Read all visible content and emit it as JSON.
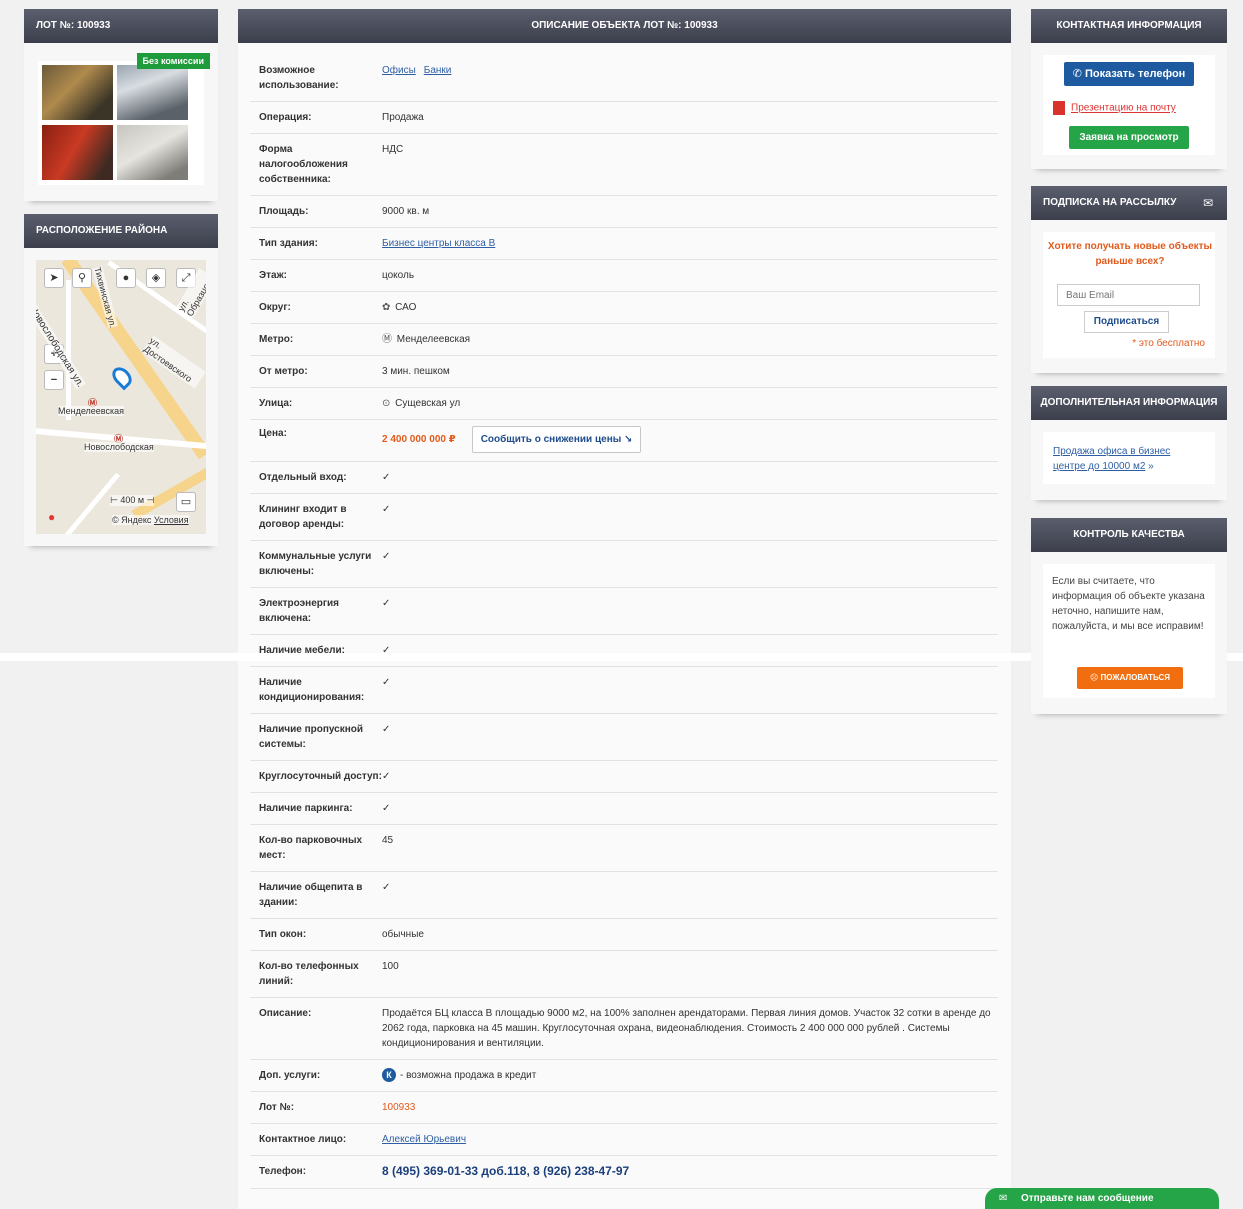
{
  "lot_panel": {
    "title": "ЛОТ №: 100933",
    "badge": "Без комиссии"
  },
  "map_panel": {
    "title": "РАСПОЛОЖЕНИЕ РАЙОНА",
    "labels": {
      "street1": "Новослободская ул.",
      "street2": "ул. Достоевского",
      "street3": "Тихвинская ул.",
      "street4": "ул. Образцова",
      "metro1": "Менделеевская",
      "metro2": "Новослободская",
      "scale": "400 м",
      "copyright": "© Яндекс",
      "terms": "Условия"
    }
  },
  "center_panel": {
    "title": "ОПИСАНИЕ ОБЪЕКТА ЛОТ №: 100933",
    "rows": [
      {
        "label": "Возможное использование:",
        "links": [
          "Офисы",
          "Банки"
        ]
      },
      {
        "label": "Операция:",
        "value": "Продажа"
      },
      {
        "label": "Форма налогообложения собственника:",
        "value": "НДС"
      },
      {
        "label": "Площадь:",
        "value": "9000 кв. м"
      },
      {
        "label": "Тип здания:",
        "links": [
          "Бизнес центры класса В"
        ]
      },
      {
        "label": "Этаж:",
        "value": "цоколь"
      },
      {
        "label": "Округ:",
        "value": "САО",
        "icon": "district-icon"
      },
      {
        "label": "Метро:",
        "value": "Менделеевская",
        "icon": "metro-icon"
      },
      {
        "label": "От метро:",
        "value": "3 мин. пешком"
      },
      {
        "label": "Улица:",
        "value": "Сущевская ул",
        "icon": "location-pin-icon"
      },
      {
        "label": "Цена:",
        "price": "2 400 000 000 ₽",
        "button": "Сообщить о снижении цены"
      },
      {
        "label": "Отдельный вход:",
        "value": "✓"
      },
      {
        "label": "Клининг входит в договор аренды:",
        "value": "✓"
      },
      {
        "label": "Коммунальные услуги включены:",
        "value": "✓"
      },
      {
        "label": "Электроэнергия включена:",
        "value": "✓"
      },
      {
        "label": "Наличие мебели:",
        "value": "✓"
      },
      {
        "label": "Наличие кондиционирования:",
        "value": "✓"
      },
      {
        "label": "Наличие пропускной системы:",
        "value": "✓"
      },
      {
        "label": "Круглосуточный доступ:",
        "value": "✓"
      },
      {
        "label": "Наличие паркинга:",
        "value": "✓"
      },
      {
        "label": "Кол-во парковочных мест:",
        "value": "45"
      },
      {
        "label": "Наличие общепита в здании:",
        "value": "✓"
      },
      {
        "label": "Тип окон:",
        "value": "обычные"
      },
      {
        "label": "Кол-во телефонных линий:",
        "value": "100"
      },
      {
        "label": "Описание:",
        "value": "Продаётся БЦ класса В площадью 9000 м2, на 100% заполнен арендаторами. Первая линия домов. Участок 32 сотки в аренде до 2062 года, парковка на 45 машин. Круглосуточная охрана, видеонаблюдения. Стоимость 2 400 000 000 рублей . Системы кондиционирования и вентиляции."
      },
      {
        "label": "Доп. услуги:",
        "value": "- возможна продажа в кредит",
        "badge": "К"
      },
      {
        "label": "Лот №:",
        "value": "100933",
        "style": "orange"
      },
      {
        "label": "Контактное лицо:",
        "links": [
          "Алексей Юрьевич"
        ]
      },
      {
        "label": "Телефон:",
        "value": "8 (495) 369-01-33 доб.118, 8 (926) 238-47-97",
        "style": "phone"
      }
    ]
  },
  "contact_panel": {
    "title": "КОНТАКТНАЯ ИНФОРМАЦИЯ",
    "show_phone": "Показать телефон",
    "presentation": "Презентацию на почту",
    "request_view": "Заявка на просмотр"
  },
  "subscribe_panel": {
    "title": "ПОДПИСКА НА РАССЫЛКУ",
    "headline": "Хотите получать новые объекты раньше всех?",
    "email_placeholder": "Ваш Email",
    "button": "Подписаться",
    "free": "* это бесплатно"
  },
  "extra_panel": {
    "title": "ДОПОЛНИТЕЛЬНАЯ ИНФОРМАЦИЯ",
    "link": "Продажа офиса в бизнес центре до 10000 м2",
    "arrow": "»"
  },
  "quality_panel": {
    "title": "КОНТРОЛЬ КАЧЕСТВА",
    "text": "Если вы считаете, что информация об объекте указана неточно, напишите нам, пожалуйста, и мы все исправим!",
    "button": "пожаловаться"
  },
  "message_bar": {
    "label": "Отправьте нам сообщение"
  },
  "colors": {
    "accent_blue": "#1d5aa0",
    "accent_green": "#26a448",
    "accent_orange": "#e25a1c",
    "header_dark": "#3c3f4b"
  }
}
